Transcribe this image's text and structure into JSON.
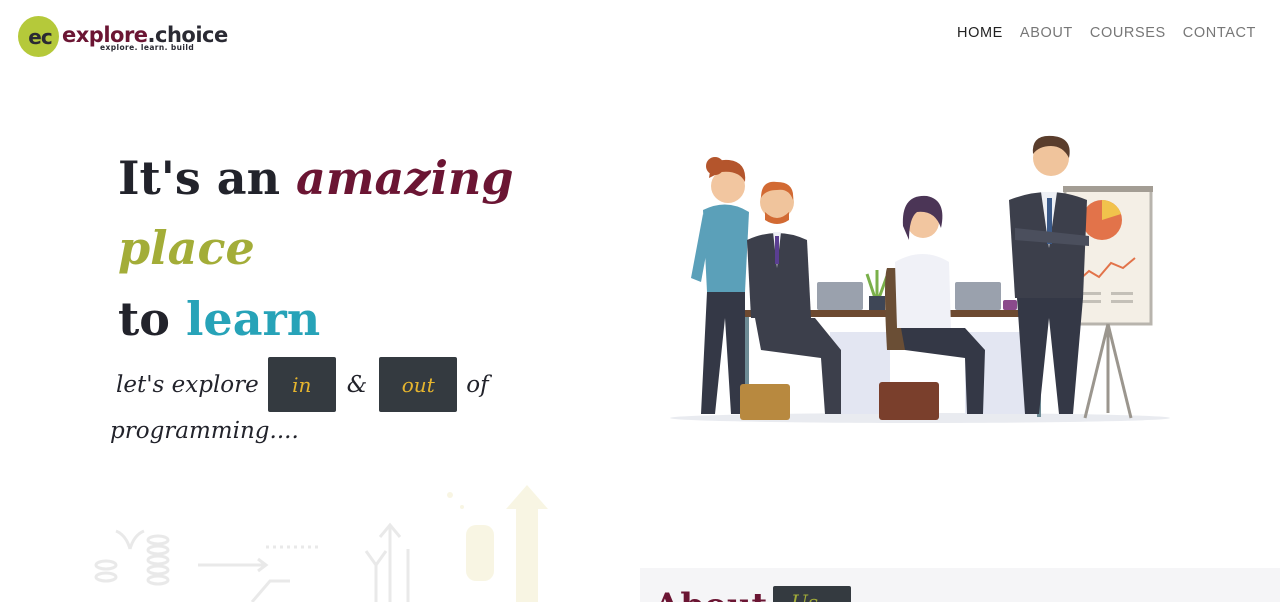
{
  "logo": {
    "mark": "ec",
    "word_part1": "explore",
    "word_part2": ".choice",
    "tagline": "explore. learn. build"
  },
  "nav": {
    "items": [
      {
        "label": "HOME",
        "active": true
      },
      {
        "label": "ABOUT",
        "active": false
      },
      {
        "label": "COURSES",
        "active": false
      },
      {
        "label": "CONTACT",
        "active": false
      }
    ]
  },
  "hero": {
    "line1_a": "It's an ",
    "line1_b": "amazing",
    "line2": "place",
    "line3_a": "to ",
    "line3_b": "learn",
    "sub_a": "let's explore",
    "chip_in": "in",
    "amp": "&",
    "chip_out": "out",
    "sub_b": "of",
    "sub_c": "programming....",
    "illustration_icon": "office-team-illustration"
  },
  "about": {
    "title": "About",
    "chip": "Us"
  },
  "colors": {
    "maroon": "#6b1533",
    "olive": "#a3ad38",
    "teal": "#27a3b8",
    "dark": "#22232b",
    "chip_bg": "#343a40",
    "chip_text": "#e6b52e"
  }
}
